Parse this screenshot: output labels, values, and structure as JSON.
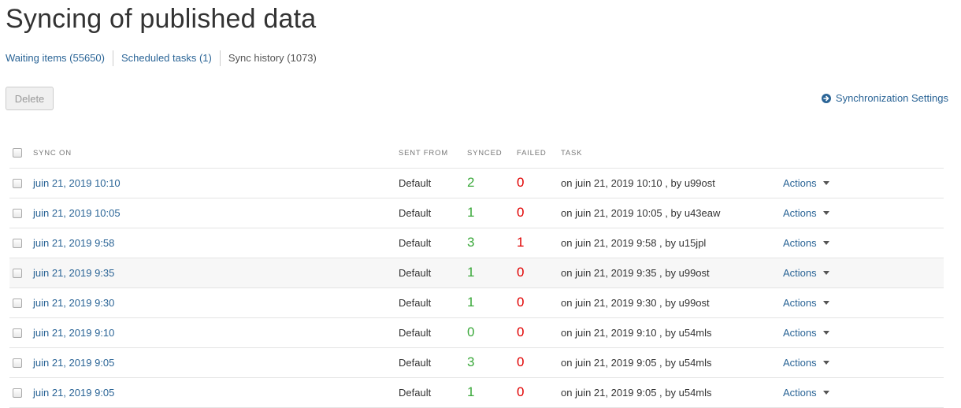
{
  "page": {
    "title": "Syncing of published data"
  },
  "tabs": [
    {
      "label": "Waiting items (55650)"
    },
    {
      "label": "Scheduled tasks (1)"
    },
    {
      "label": "Sync history (1073)"
    }
  ],
  "toolbar": {
    "delete_label": "Delete",
    "settings_label": "Synchronization Settings"
  },
  "table": {
    "headers": {
      "sync_on": "SYNC ON",
      "sent_from": "SENT FROM",
      "synced": "SYNCED",
      "failed": "FAILED",
      "task": "TASK"
    },
    "rows": [
      {
        "sync_on": "juin 21, 2019 10:10",
        "sent_from": "Default",
        "synced": "2",
        "failed": "0",
        "task": "on juin 21, 2019 10:10 , by u99ost",
        "actions": "Actions"
      },
      {
        "sync_on": "juin 21, 2019 10:05",
        "sent_from": "Default",
        "synced": "1",
        "failed": "0",
        "task": "on juin 21, 2019 10:05 , by u43eaw",
        "actions": "Actions"
      },
      {
        "sync_on": "juin 21, 2019 9:58",
        "sent_from": "Default",
        "synced": "3",
        "failed": "1",
        "task": "on juin 21, 2019 9:58 , by u15jpl",
        "actions": "Actions"
      },
      {
        "sync_on": "juin 21, 2019 9:35",
        "sent_from": "Default",
        "synced": "1",
        "failed": "0",
        "task": "on juin 21, 2019 9:35 , by u99ost",
        "actions": "Actions"
      },
      {
        "sync_on": "juin 21, 2019 9:30",
        "sent_from": "Default",
        "synced": "1",
        "failed": "0",
        "task": "on juin 21, 2019 9:30 , by u99ost",
        "actions": "Actions"
      },
      {
        "sync_on": "juin 21, 2019 9:10",
        "sent_from": "Default",
        "synced": "0",
        "failed": "0",
        "task": "on juin 21, 2019 9:10 , by u54mls",
        "actions": "Actions"
      },
      {
        "sync_on": "juin 21, 2019 9:05",
        "sent_from": "Default",
        "synced": "3",
        "failed": "0",
        "task": "on juin 21, 2019 9:05 , by u54mls",
        "actions": "Actions"
      },
      {
        "sync_on": "juin 21, 2019 9:05",
        "sent_from": "Default",
        "synced": "1",
        "failed": "0",
        "task": "on juin 21, 2019 9:05 , by u54mls",
        "actions": "Actions"
      }
    ]
  },
  "colors": {
    "link": "#2a6496",
    "synced": "#3aa83a",
    "failed": "#e00000"
  }
}
